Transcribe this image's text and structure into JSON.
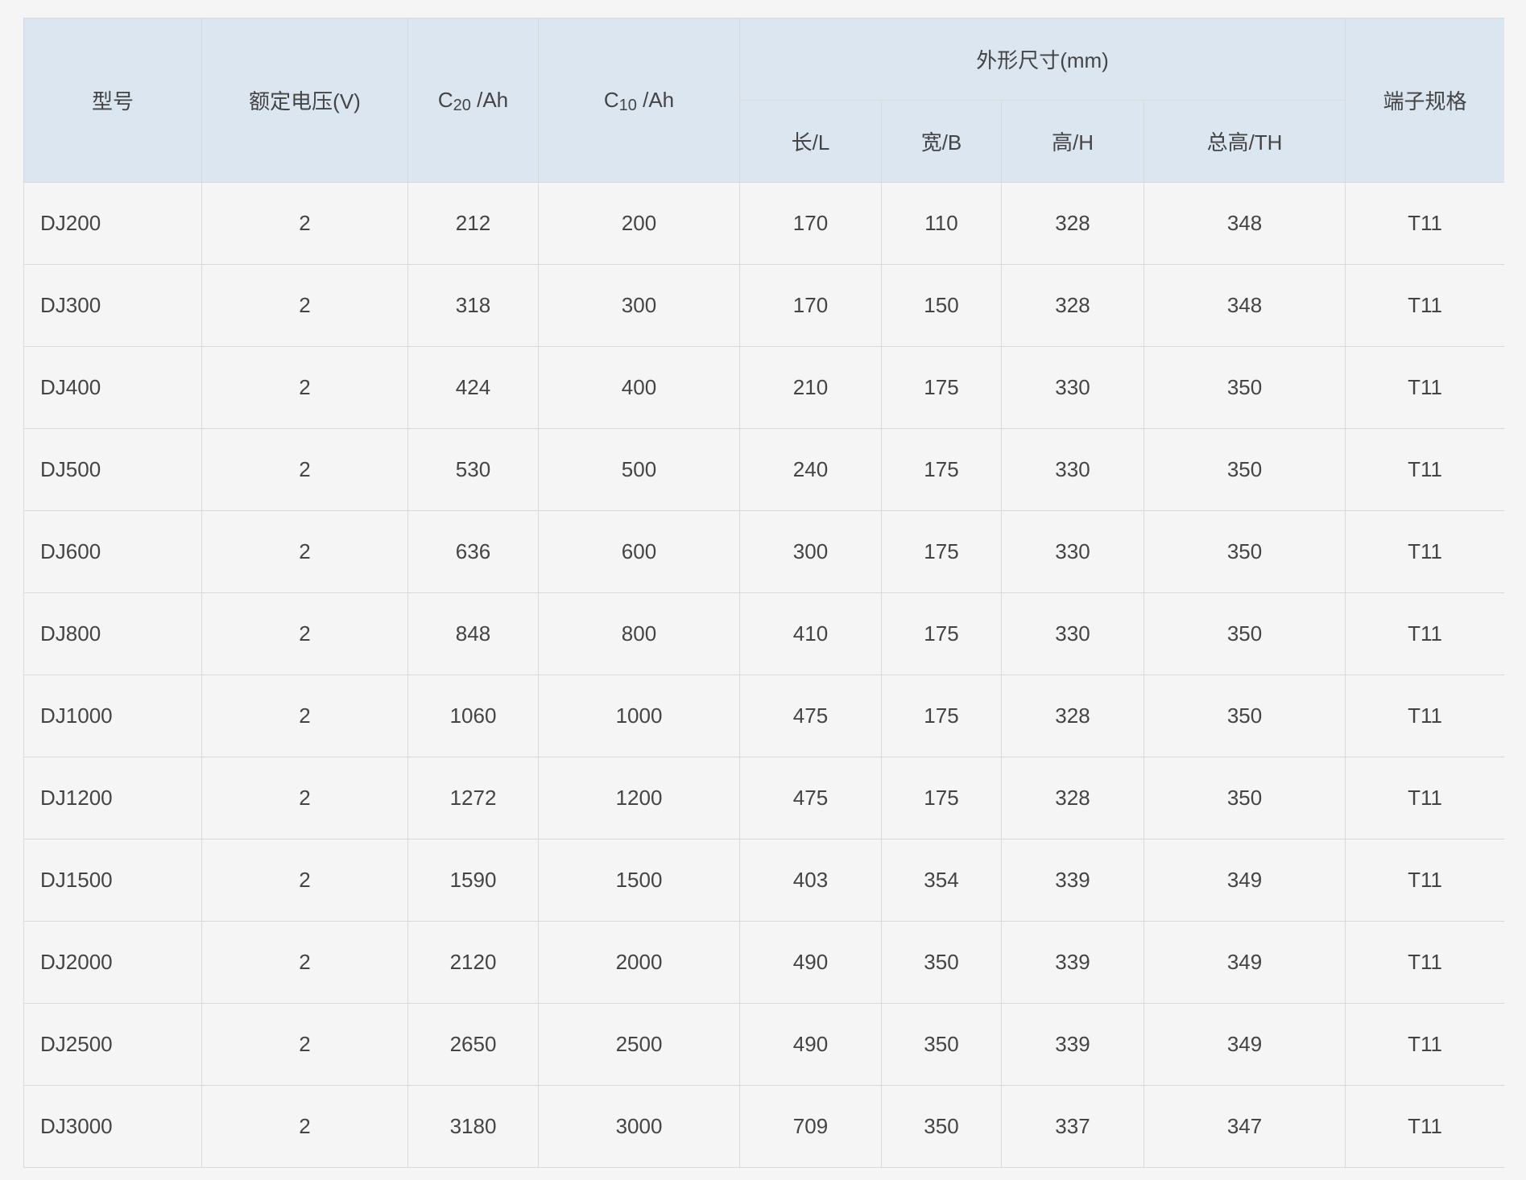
{
  "table": {
    "headers": {
      "model": "型号",
      "voltage": "额定电压(V)",
      "c20_prefix": "C",
      "c20_sub": "20",
      "c20_suffix": " /Ah",
      "c10_prefix": "C",
      "c10_sub": "10",
      "c10_suffix": " /Ah",
      "dimensions_group": "外形尺寸(mm)",
      "length": "长/L",
      "width": "宽/B",
      "height": "高/H",
      "total_height": "总高/TH",
      "terminal": "端子规格"
    },
    "rows": [
      [
        "DJ200",
        "2",
        "212",
        "200",
        "170",
        "110",
        "328",
        "348",
        "T11"
      ],
      [
        "DJ300",
        "2",
        "318",
        "300",
        "170",
        "150",
        "328",
        "348",
        "T11"
      ],
      [
        "DJ400",
        "2",
        "424",
        "400",
        "210",
        "175",
        "330",
        "350",
        "T11"
      ],
      [
        "DJ500",
        "2",
        "530",
        "500",
        "240",
        "175",
        "330",
        "350",
        "T11"
      ],
      [
        "DJ600",
        "2",
        "636",
        "600",
        "300",
        "175",
        "330",
        "350",
        "T11"
      ],
      [
        "DJ800",
        "2",
        "848",
        "800",
        "410",
        "175",
        "330",
        "350",
        "T11"
      ],
      [
        "DJ1000",
        "2",
        "1060",
        "1000",
        "475",
        "175",
        "328",
        "350",
        "T11"
      ],
      [
        "DJ1200",
        "2",
        "1272",
        "1200",
        "475",
        "175",
        "328",
        "350",
        "T11"
      ],
      [
        "DJ1500",
        "2",
        "1590",
        "1500",
        "403",
        "354",
        "339",
        "349",
        "T11"
      ],
      [
        "DJ2000",
        "2",
        "2120",
        "2000",
        "490",
        "350",
        "339",
        "349",
        "T11"
      ],
      [
        "DJ2500",
        "2",
        "2650",
        "2500",
        "490",
        "350",
        "339",
        "349",
        "T11"
      ],
      [
        "DJ3000",
        "2",
        "3180",
        "3000",
        "709",
        "350",
        "337",
        "347",
        "T11"
      ]
    ]
  }
}
